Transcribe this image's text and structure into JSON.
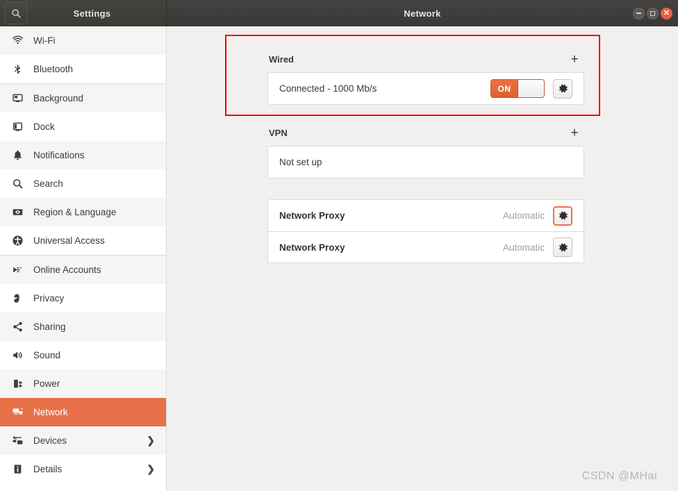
{
  "window": {
    "sidebar_title": "Settings",
    "title": "Network",
    "search_icon": "search-icon",
    "controls": {
      "minimize": "minimize-icon",
      "maximize": "maximize-icon",
      "close": "close-icon"
    }
  },
  "sidebar": {
    "items": [
      {
        "label": "Wi-Fi",
        "icon": "wifi-icon",
        "active": false,
        "chevron": false
      },
      {
        "label": "Bluetooth",
        "icon": "bluetooth-icon",
        "active": false,
        "chevron": false
      },
      {
        "label": "Background",
        "icon": "background-icon",
        "active": false,
        "chevron": false
      },
      {
        "label": "Dock",
        "icon": "dock-icon",
        "active": false,
        "chevron": false
      },
      {
        "label": "Notifications",
        "icon": "bell-icon",
        "active": false,
        "chevron": false
      },
      {
        "label": "Search",
        "icon": "search-icon",
        "active": false,
        "chevron": false
      },
      {
        "label": "Region & Language",
        "icon": "region-language-icon",
        "active": false,
        "chevron": false
      },
      {
        "label": "Universal Access",
        "icon": "universal-access-icon",
        "active": false,
        "chevron": false
      },
      {
        "label": "Online Accounts",
        "icon": "online-accounts-icon",
        "active": false,
        "chevron": false
      },
      {
        "label": "Privacy",
        "icon": "privacy-hand-icon",
        "active": false,
        "chevron": false
      },
      {
        "label": "Sharing",
        "icon": "sharing-icon",
        "active": false,
        "chevron": false
      },
      {
        "label": "Sound",
        "icon": "sound-icon",
        "active": false,
        "chevron": false
      },
      {
        "label": "Power",
        "icon": "power-icon",
        "active": false,
        "chevron": false
      },
      {
        "label": "Network",
        "icon": "network-icon",
        "active": true,
        "chevron": false
      },
      {
        "label": "Devices",
        "icon": "devices-icon",
        "active": false,
        "chevron": true
      },
      {
        "label": "Details",
        "icon": "details-info-icon",
        "active": false,
        "chevron": true
      }
    ]
  },
  "main": {
    "wired": {
      "title": "Wired",
      "add_label": "+",
      "connection_status": "Connected - 1000 Mb/s",
      "toggle_state": "ON",
      "settings_icon": "gear-icon"
    },
    "vpn": {
      "title": "VPN",
      "add_label": "+",
      "status": "Not set up"
    },
    "proxy_rows": [
      {
        "label": "Network Proxy",
        "value": "Automatic",
        "settings_icon": "gear-icon",
        "focused": true
      },
      {
        "label": "Network Proxy",
        "value": "Automatic",
        "settings_icon": "gear-icon",
        "focused": false
      }
    ]
  },
  "annotation": {
    "highlight_color": "#f40000",
    "watermark": "CSDN @MHai"
  },
  "colors": {
    "accent": "#e8714a",
    "toggle_on": "#e05f2e",
    "sidebar_bg": "#ffffff",
    "content_bg": "#f1f0ee",
    "titlebar_bg": "#3b3937"
  }
}
